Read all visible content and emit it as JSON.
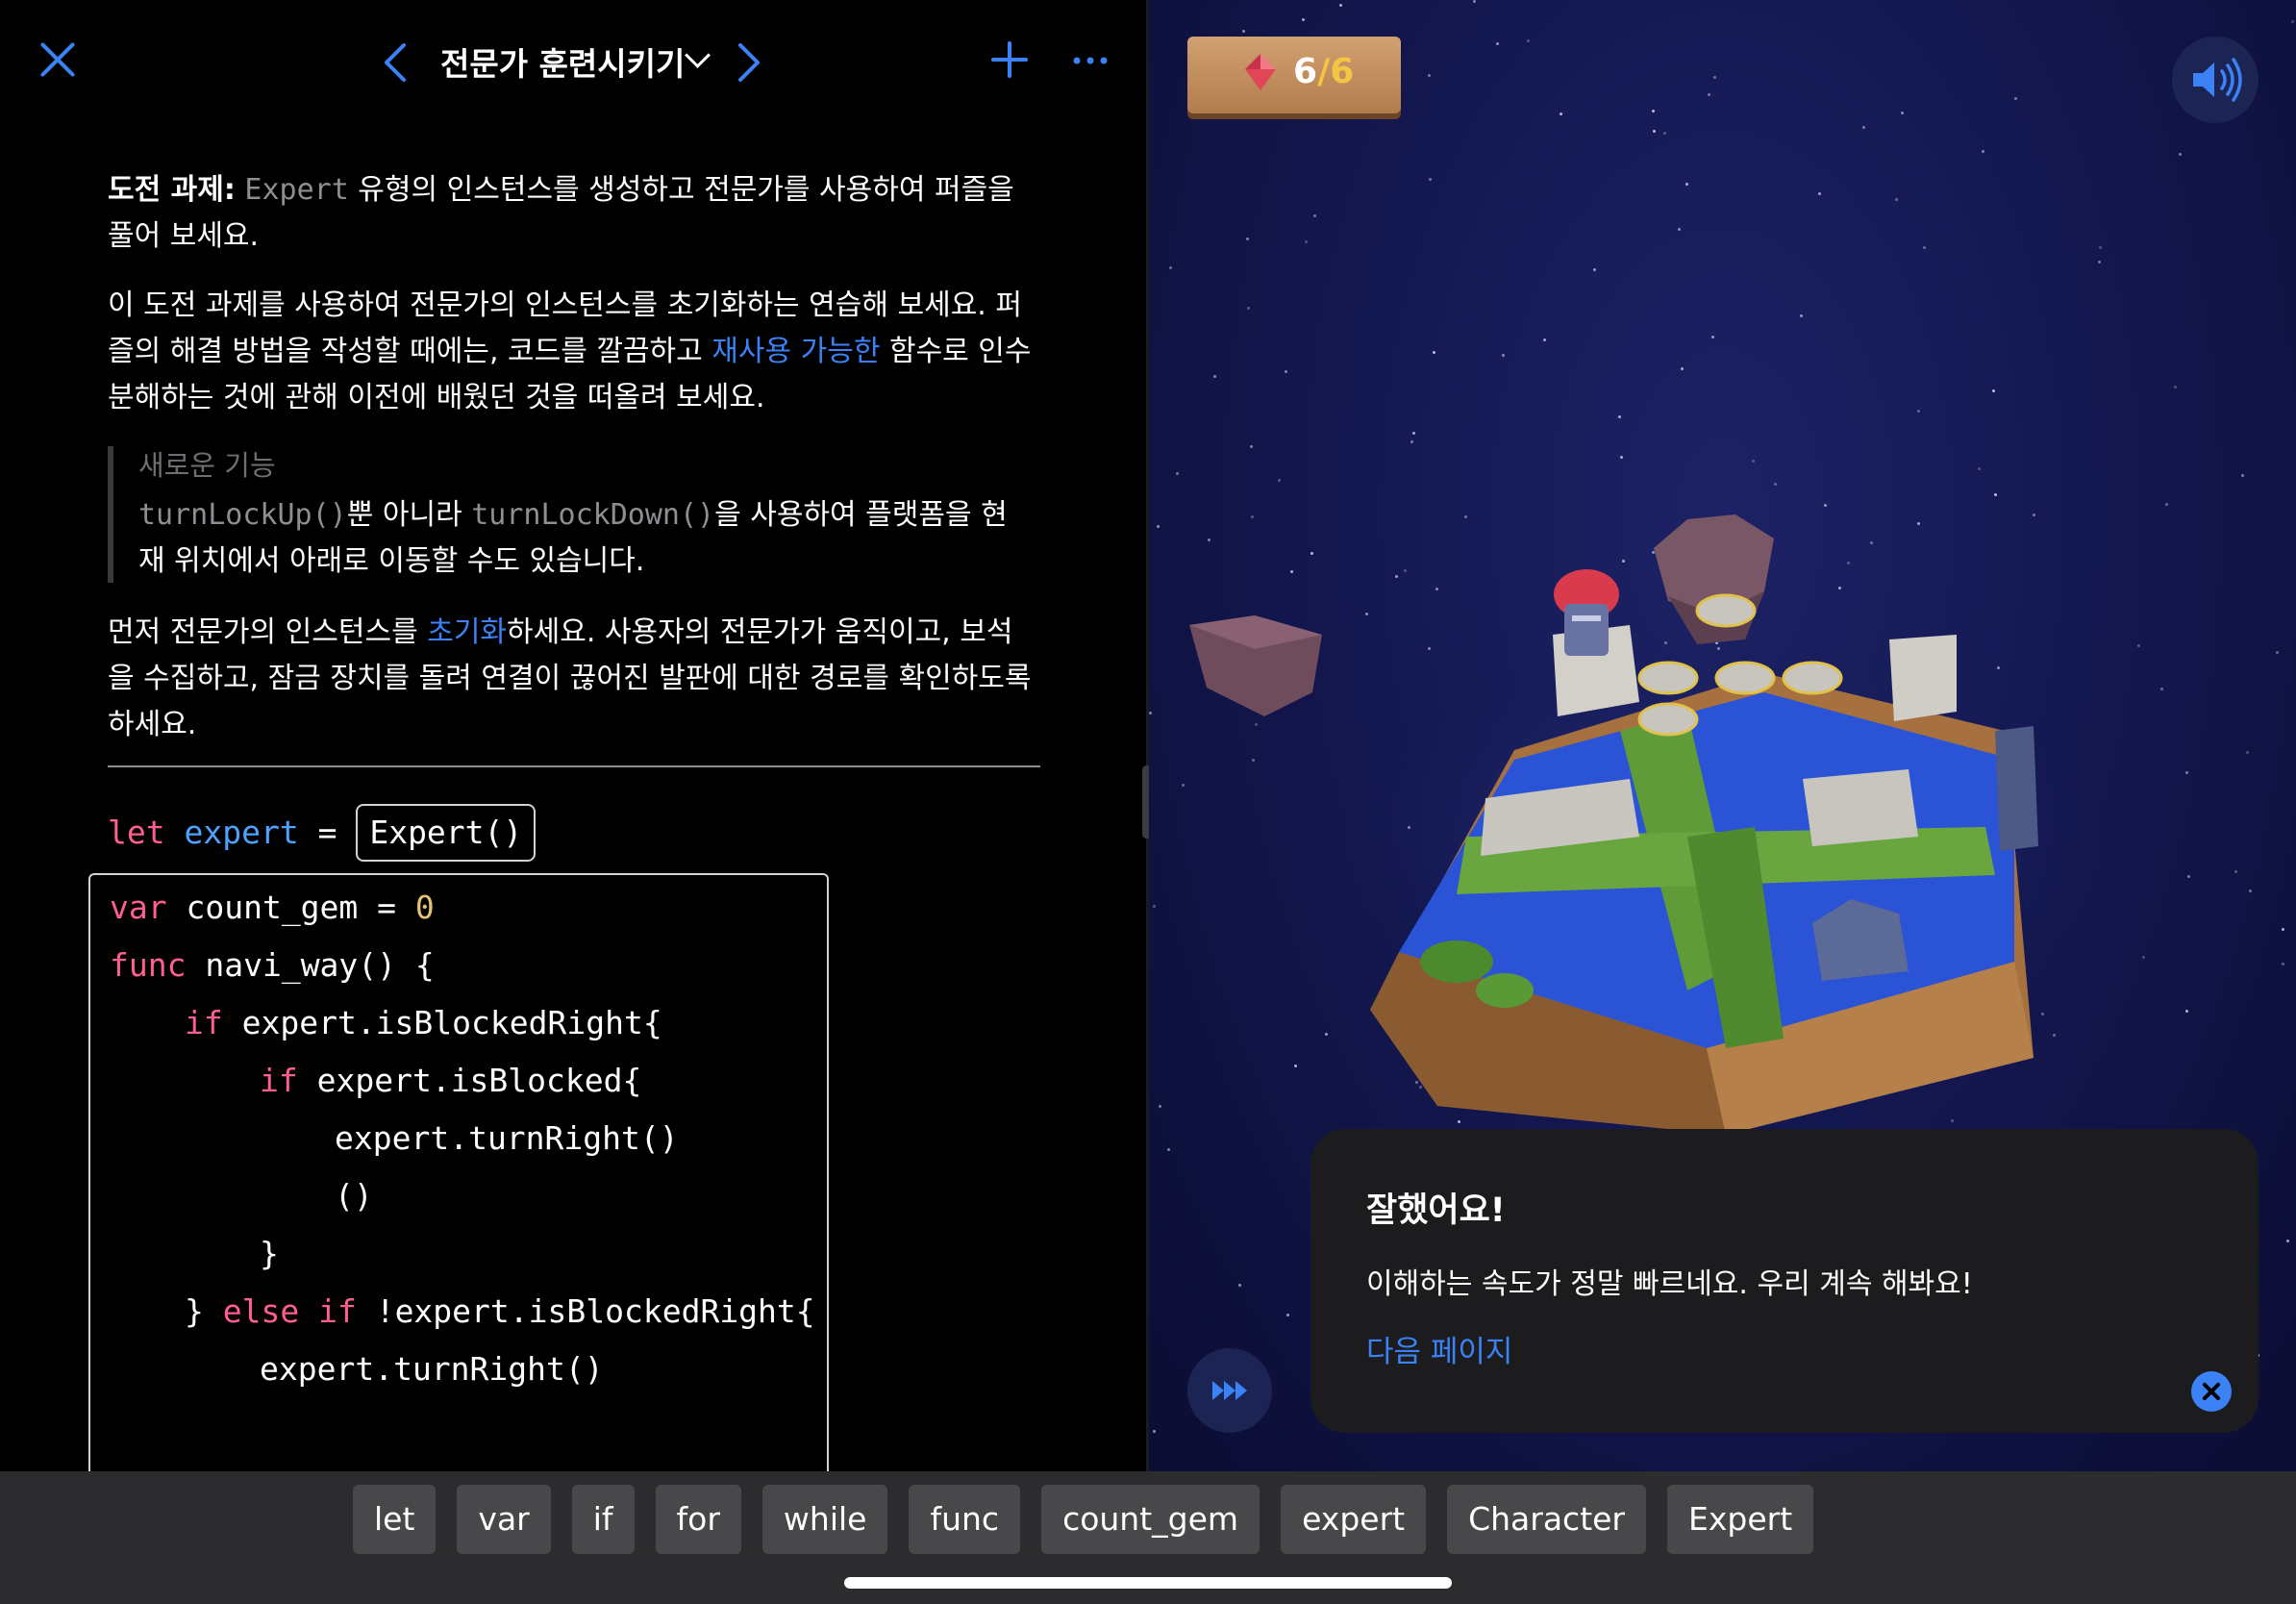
{
  "nav": {
    "title": "전문가 훈련시키기",
    "prev_icon": "chevron-left-icon",
    "next_icon": "chevron-right-icon",
    "close_icon": "close-icon",
    "add_icon": "plus-icon",
    "more_icon": "ellipsis-icon"
  },
  "instructions": {
    "challenge_label": "도전 과제:",
    "challenge_code": "Expert",
    "challenge_text": " 유형의 인스턴스를 생성하고 전문가를 사용하여 퍼즐을 풀어 보세요.",
    "para2_a": "이 도전 과제를 사용하여 전문가의 인스턴스를 초기화하는 연습해 보세요. 퍼즐의 해결 방법을 작성할 때에는, 코드를 깔끔하고 ",
    "para2_link": "재사용 가능한",
    "para2_b": " 함수로 인수분해하는 것에 관해 이전에 배웠던 것을 떠올려 보세요.",
    "callout_title": "새로운 기능",
    "callout_code1": "turnLockUp()",
    "callout_mid": "뿐 아니라 ",
    "callout_code2": "turnLockDown()",
    "callout_rest": "을 사용하여 플랫폼을 현재 위치에서 아래로 이동할 수도 있습니다.",
    "para3_a": "먼저 전문가의 인스턴스를 ",
    "para3_link": "초기화",
    "para3_b": "하세요. 사용자의 전문가가 움직이고, 보석을 수집하고, 잠금 장치를 돌려 연결이 끊어진 발판에 대한 경로를 확인하도록 하세요."
  },
  "code": {
    "let_kw": "let",
    "let_name": "expert",
    "let_eq": "=",
    "let_value": "Expert()",
    "lines": [
      {
        "t": "var",
        "r": " count_gem = ",
        "n": "0"
      },
      {
        "t": "func",
        "r": " navi_way() {"
      },
      {
        "t": "if",
        "r": " expert.isBlockedRight{"
      },
      {
        "t": "if",
        "r": " expert.isBlocked{"
      },
      {
        "r": "expert.turnRight()"
      },
      {
        "r": "()"
      },
      {
        "r": "}"
      },
      {
        "p": "} ",
        "t": "else if",
        "r": " !expert.isBlockedRight{"
      },
      {
        "r": "expert.turnRight()"
      }
    ]
  },
  "game": {
    "gem_icon": "gem-icon",
    "gems_collected": "6",
    "gems_separator": "/",
    "gems_total": "6",
    "sound_icon": "speaker-icon",
    "fast_forward_icon": "fast-forward-icon"
  },
  "popup": {
    "title": "잘했어요!",
    "message": "이해하는 속도가 정말 빠르네요. 우리 계속 해봐요!",
    "next_link": "다음 페이지",
    "close_icon": "close-circle-icon"
  },
  "keyword_bar": {
    "chips": [
      "let",
      "var",
      "if",
      "for",
      "while",
      "func",
      "count_gem",
      "expert",
      "Character",
      "Expert"
    ]
  }
}
